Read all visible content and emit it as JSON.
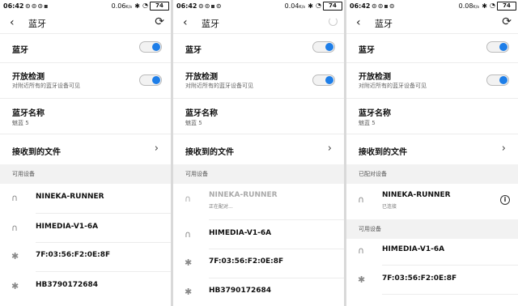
{
  "screens": [
    {
      "status": {
        "time": "06:42",
        "net": "0.06",
        "battery": "74"
      },
      "header": {
        "title": "蓝牙"
      },
      "bluetooth": {
        "label": "蓝牙"
      },
      "discoverable": {
        "label": "开放检测",
        "sub": "对附近所有的蓝牙设备可见"
      },
      "device_name": {
        "label": "蓝牙名称",
        "value": "魅蓝 5"
      },
      "received": {
        "label": "接收到的文件"
      },
      "available_header": "可用设备",
      "devices": [
        {
          "name": "NINEKA-RUNNER",
          "icon": "headphones-icon"
        },
        {
          "name": "HIMEDIA-V1-6A",
          "icon": "headphones-icon"
        },
        {
          "name": "7F:03:56:F2:0E:8F",
          "icon": "bluetooth-icon"
        },
        {
          "name": "HB3790172684",
          "icon": "bluetooth-icon"
        }
      ]
    },
    {
      "status": {
        "time": "06:42",
        "net": "0.04",
        "battery": "74"
      },
      "header": {
        "title": "蓝牙"
      },
      "bluetooth": {
        "label": "蓝牙"
      },
      "discoverable": {
        "label": "开放检测",
        "sub": "对附近所有的蓝牙设备可见"
      },
      "device_name": {
        "label": "蓝牙名称",
        "value": "魅蓝 5"
      },
      "received": {
        "label": "接收到的文件"
      },
      "available_header": "可用设备",
      "devices": [
        {
          "name": "NINEKA-RUNNER",
          "icon": "headphones-icon",
          "sub": "正在配对..."
        },
        {
          "name": "HIMEDIA-V1-6A",
          "icon": "headphones-icon"
        },
        {
          "name": "7F:03:56:F2:0E:8F",
          "icon": "bluetooth-icon"
        },
        {
          "name": "HB3790172684",
          "icon": "bluetooth-icon"
        }
      ]
    },
    {
      "status": {
        "time": "06:42",
        "net": "0.08",
        "battery": "74"
      },
      "header": {
        "title": "蓝牙"
      },
      "bluetooth": {
        "label": "蓝牙"
      },
      "discoverable": {
        "label": "开放检测",
        "sub": "对附近所有的蓝牙设备可见"
      },
      "device_name": {
        "label": "蓝牙名称",
        "value": "魅蓝 5"
      },
      "received": {
        "label": "接收到的文件"
      },
      "paired_header": "已配对设备",
      "paired": {
        "name": "NINEKA-RUNNER",
        "sub": "已连接",
        "icon": "headphones-icon"
      },
      "available_header": "可用设备",
      "devices": [
        {
          "name": "HIMEDIA-V1-6A",
          "icon": "headphones-icon"
        },
        {
          "name": "7F:03:56:F2:0E:8F",
          "icon": "bluetooth-icon"
        }
      ]
    }
  ],
  "colors": {
    "accent": "#1e7ee8",
    "section_bg": "#f2f2f2"
  }
}
